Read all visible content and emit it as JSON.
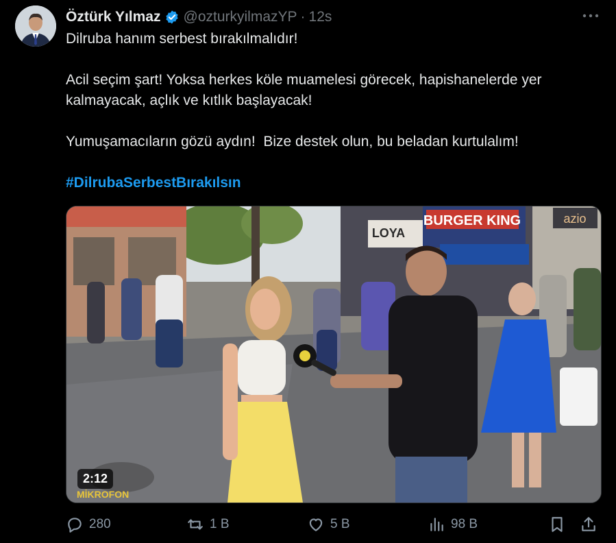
{
  "author": {
    "name": "Öztürk Yılmaz",
    "handle": "@ozturkyilmazYP",
    "separator": "·",
    "time": "12s"
  },
  "tweet": {
    "line1": "Dilruba hanım serbest bırakılmalıdır!",
    "line2": "Acil seçim şart! Yoksa herkes köle muamelesi görecek, hapishanelerde yer kalmayacak, açlık ve kıtlık başlayacak!",
    "line3": "Yumuşamacıların gözü aydın!  Bize destek olun, bu beladan kurtulalım!",
    "hashtag": "#DilrubaSerbestBırakılsın"
  },
  "media": {
    "duration": "2:12",
    "store_sign_1": "BURGER KING",
    "store_sign_2": "LOYA",
    "store_sign_3": "azio",
    "watermark": "MİKROFON"
  },
  "actions": {
    "replies": "280",
    "reposts": "1 B",
    "likes": "5 B",
    "views": "98 B"
  },
  "colors": {
    "background": "#000000",
    "text": "#e7e9ea",
    "muted": "#71767b",
    "accent": "#1d9bf0"
  },
  "icons": [
    "avatar",
    "verified-badge-icon",
    "more-icon",
    "reply-icon",
    "repost-icon",
    "like-icon",
    "views-icon",
    "bookmark-icon",
    "share-icon"
  ]
}
